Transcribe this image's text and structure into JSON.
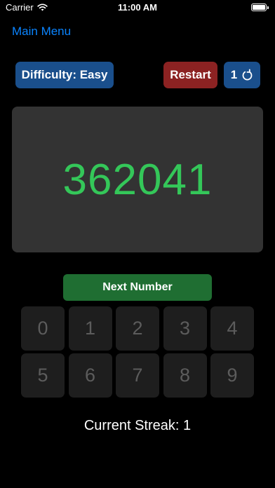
{
  "status_bar": {
    "carrier": "Carrier",
    "time": "11:00 AM",
    "battery_level": 1.0
  },
  "nav": {
    "main_menu_label": "Main Menu"
  },
  "controls": {
    "difficulty_label": "Difficulty: Easy",
    "restart_label": "Restart",
    "counter_value": "1",
    "counter_icon": "refresh-icon"
  },
  "display": {
    "number": "362041"
  },
  "next_button_label": "Next Number",
  "keypad": {
    "keys": [
      "0",
      "1",
      "2",
      "3",
      "4",
      "5",
      "6",
      "7",
      "8",
      "9"
    ]
  },
  "streak": {
    "text": "Current Streak: 1"
  },
  "colors": {
    "accent_blue": "#0a84ff",
    "button_blue": "#1a4f8c",
    "button_red": "#8c2222",
    "number_green": "#34c759",
    "next_green": "#1f6e32"
  }
}
